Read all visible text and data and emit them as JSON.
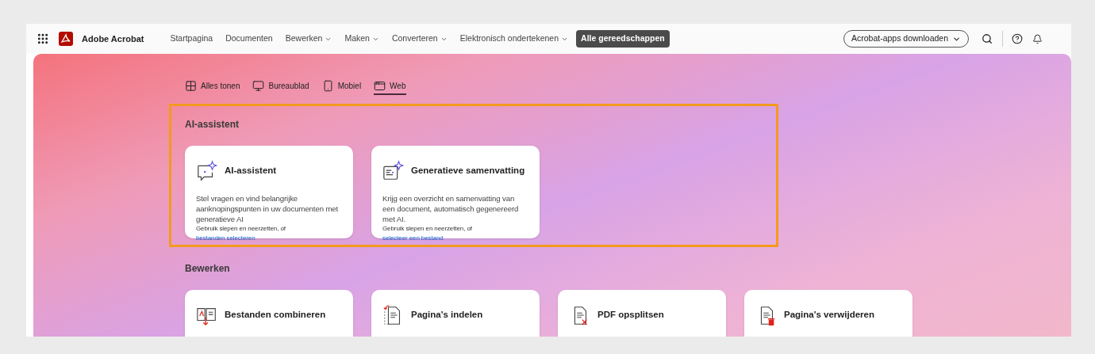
{
  "app": {
    "name": "Adobe Acrobat"
  },
  "nav": [
    {
      "label": "Startpagina",
      "has_menu": false,
      "selected": false
    },
    {
      "label": "Documenten",
      "has_menu": false,
      "selected": false
    },
    {
      "label": "Bewerken",
      "has_menu": true,
      "selected": false
    },
    {
      "label": "Maken",
      "has_menu": true,
      "selected": false
    },
    {
      "label": "Converteren",
      "has_menu": true,
      "selected": false
    },
    {
      "label": "Elektronisch ondertekenen",
      "has_menu": true,
      "selected": false
    },
    {
      "label": "Alle gereedschappen",
      "has_menu": false,
      "selected": true
    }
  ],
  "download_button": "Acrobat-apps downloaden",
  "filters": [
    {
      "label": "Alles tonen",
      "kind": "grid",
      "selected": false
    },
    {
      "label": "Bureaublad",
      "kind": "desktop",
      "selected": false
    },
    {
      "label": "Mobiel",
      "kind": "mobile",
      "selected": false
    },
    {
      "label": "Web",
      "kind": "web",
      "selected": true
    }
  ],
  "sections": [
    {
      "title": "AI-assistent",
      "highlighted": true,
      "cards": [
        {
          "kind": "chat",
          "title": "AI-assistent",
          "description": "Stel vragen en vind belangrijke aanknopingspunten in uw documenten met generatieve AI",
          "hint": "Gebruik slepen en neerzetten, of ",
          "link": "bestanden selecteren"
        },
        {
          "kind": "summary",
          "title": "Generatieve samenvatting",
          "description": "Krijg een overzicht en samenvatting van een document, automatisch gegenereerd met AI.",
          "hint": "Gebruik slepen en neerzetten, of ",
          "link": "selecteer een bestand"
        }
      ]
    },
    {
      "title": "Bewerken",
      "highlighted": false,
      "cards": [
        {
          "kind": "combine",
          "title": "Bestanden combineren"
        },
        {
          "kind": "organize",
          "title": "Pagina's indelen"
        },
        {
          "kind": "split",
          "title": "PDF opsplitsen"
        },
        {
          "kind": "delete",
          "title": "Pagina's verwijderen"
        }
      ]
    }
  ]
}
